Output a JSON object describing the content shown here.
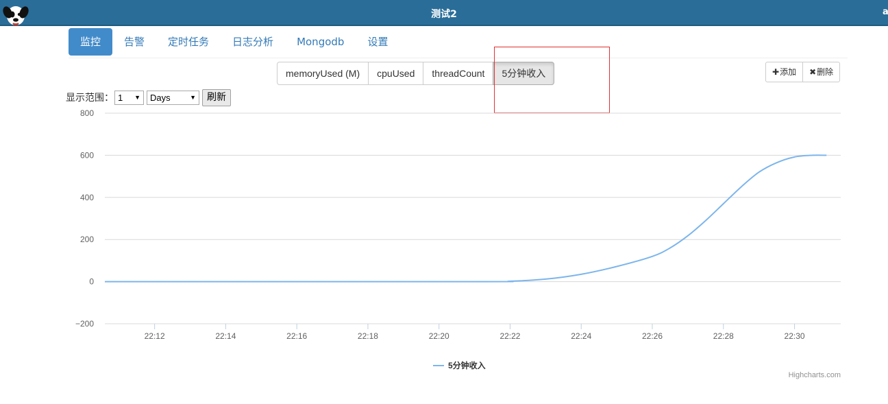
{
  "header": {
    "title": "测试2",
    "user_initial": "a"
  },
  "nav": {
    "tabs": [
      "监控",
      "告警",
      "定时任务",
      "日志分析",
      "Mongodb",
      "设置"
    ]
  },
  "metrics": {
    "buttons": [
      "memoryUsed (M)",
      "cpuUsed",
      "threadCount",
      "5分钟收入"
    ],
    "active_index": 3
  },
  "actions": {
    "add_label": "添加",
    "delete_label": "删除"
  },
  "range": {
    "label": "显示范围：",
    "amount": "1",
    "unit": "Days",
    "refresh_label": "刷新"
  },
  "highlight_color": "#e03030",
  "chart_data": {
    "type": "line",
    "title": "",
    "xlabel": "",
    "ylabel": "",
    "x_tick_labels": [
      "22:12",
      "22:14",
      "22:16",
      "22:18",
      "22:20",
      "22:22",
      "22:24",
      "22:26",
      "22:28",
      "22:30"
    ],
    "y_tick_labels": [
      "800",
      "600",
      "400",
      "200",
      "0",
      "−200"
    ],
    "ylim": [
      -200,
      800
    ],
    "xlim_minutes": [
      10.6,
      31.3
    ],
    "grid": true,
    "legend_position": "bottom-center",
    "series": [
      {
        "name": "5分钟收入",
        "color": "#7cb5ec",
        "x_minutes": [
          10.6,
          21.0,
          22.0,
          23.0,
          24.0,
          25.0,
          26.0,
          26.5,
          27.0,
          27.5,
          28.0,
          28.5,
          29.0,
          29.5,
          30.0,
          30.5,
          30.9
        ],
        "values": [
          0,
          0,
          2,
          12,
          35,
          72,
          120,
          160,
          218,
          290,
          370,
          450,
          520,
          565,
          592,
          600,
          600
        ]
      }
    ],
    "credits": "Highcharts.com"
  }
}
